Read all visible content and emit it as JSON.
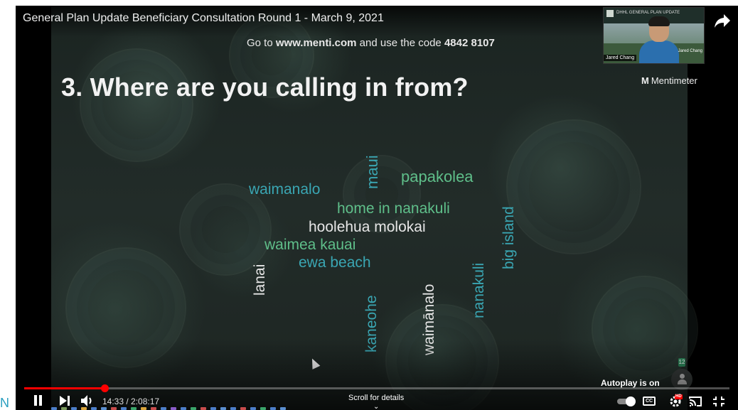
{
  "video": {
    "title": "General Plan Update Beneficiary Consultation Round 1 - March 9, 2021"
  },
  "slide": {
    "instruction_prefix": "Go to",
    "instruction_url": "www.menti.com",
    "instruction_middle": "and use the code",
    "instruction_code": "4842 8107",
    "question": "3. Where are you calling in from?",
    "brand": "Mentimeter",
    "brand_mark": "M",
    "word_cloud": [
      {
        "text": "waimanalo",
        "color": "#3aa6b3"
      },
      {
        "text": "maui",
        "color": "#3aa6b3"
      },
      {
        "text": "papakolea",
        "color": "#5fbf8a"
      },
      {
        "text": "home in nanakuli",
        "color": "#5fbf8a"
      },
      {
        "text": "hoolehua molokai",
        "color": "#e6e6e6"
      },
      {
        "text": "waimea kauai",
        "color": "#5fbf8a"
      },
      {
        "text": "ewa beach",
        "color": "#3aa6b3"
      },
      {
        "text": "lanai",
        "color": "#e6e6e6"
      },
      {
        "text": "kaneohe",
        "color": "#3aa6b3"
      },
      {
        "text": "waimānalo",
        "color": "#e6e6e6"
      },
      {
        "text": "nanakuli",
        "color": "#3aa6b3"
      },
      {
        "text": "big island",
        "color": "#3aa6b3"
      }
    ],
    "participant_count": "12"
  },
  "webcam": {
    "name": "Jared Chang",
    "name_secondary": "Jared Chang",
    "banner": "DHHL GENERAL PLAN UPDATE"
  },
  "player": {
    "current_time": "14:33",
    "duration": "2:08:17",
    "time_separator": " / ",
    "progress_fraction": 0.1135,
    "autoplay_label": "Autoplay is on",
    "scroll_hint": "Scroll for details",
    "scroll_chevron": "⌄",
    "cc_label": "CC",
    "hd_label": "HD",
    "accent_color": "#ff0000"
  },
  "background": {
    "partial_letter": "N"
  }
}
